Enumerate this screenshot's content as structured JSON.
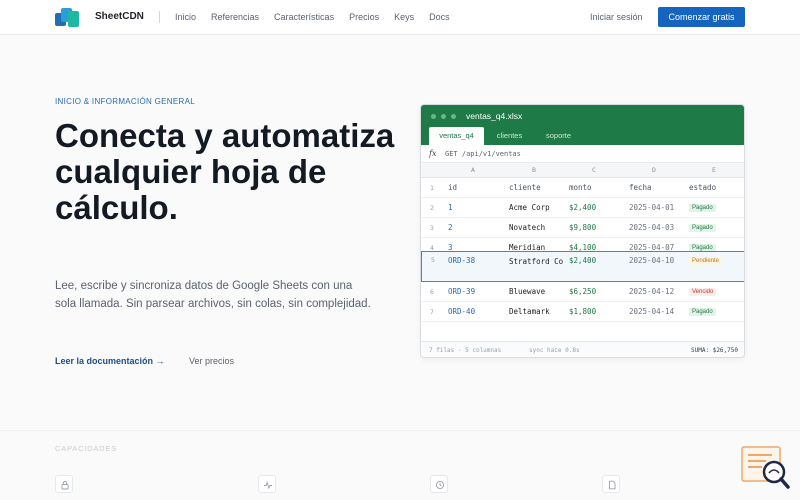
{
  "nav": {
    "brand": "SheetCDN",
    "links": [
      "Inicio",
      "Referencias",
      "Características",
      "Precios",
      "Keys",
      "Docs"
    ],
    "signin": "Iniciar sesión",
    "cta": "Comenzar gratis"
  },
  "hero": {
    "eyebrow": "INICIO & INFORMACIÓN GENERAL",
    "headline": "Conecta y automatiza cualquier hoja de cálculo.",
    "subtitle": "Lee, escribe y sincroniza datos de Google Sheets con una sola llamada. Sin parsear archivos, sin colas, sin complejidad.",
    "doc_link": "Leer la documentación →",
    "price_link": "Ver precios"
  },
  "sheet": {
    "filename": "ventas_q4.xlsx",
    "tabs": [
      "ventas_q4",
      "clientes",
      "soporte"
    ],
    "fx_label": "fx",
    "fx_value": "GET /api/v1/ventas",
    "col_letters": [
      "A",
      "B",
      "C",
      "D",
      "E"
    ],
    "header_row": {
      "num": "1",
      "cells": [
        "id",
        "cliente",
        "monto",
        "fecha",
        "estado"
      ]
    },
    "rows": [
      {
        "num": "2",
        "id": "1",
        "cliente": "Acme Corp",
        "monto": "$2,400",
        "fecha": "2025-04-01",
        "estado": "Pagado",
        "status": "paid"
      },
      {
        "num": "3",
        "id": "2",
        "cliente": "Novatech",
        "monto": "$9,800",
        "fecha": "2025-04-03",
        "estado": "Pagado",
        "status": "paid"
      },
      {
        "num": "4",
        "id": "3",
        "cliente": "Meridian",
        "monto": "$4,100",
        "fecha": "2025-04-07",
        "estado": "Pagado",
        "status": "paid"
      },
      {
        "num": "5",
        "id": "ORD-38",
        "cliente": "Stratford Co",
        "monto": "$2,400",
        "fecha": "2025-04-10",
        "estado": "Pendiente",
        "status": "pend"
      },
      {
        "num": "6",
        "id": "ORD-39",
        "cliente": "Bluewave",
        "monto": "$6,250",
        "fecha": "2025-04-12",
        "estado": "Vencido",
        "status": "late"
      },
      {
        "num": "7",
        "id": "ORD-40",
        "cliente": "Deltamark",
        "monto": "$1,800",
        "fecha": "2025-04-14",
        "estado": "Pagado",
        "status": "paid"
      }
    ],
    "footer_rows": "7 filas · 5 columnas",
    "footer_sync": "sync hace 0.8s",
    "footer_sum": "SUMA: $26,750"
  },
  "capabilities": {
    "label": "CAPACIDADES",
    "icons": [
      "lock-icon",
      "activity-icon",
      "clock-icon",
      "document-icon"
    ]
  },
  "colors": {
    "accent": "#1565c0",
    "sheet_green": "#1e7a46"
  }
}
